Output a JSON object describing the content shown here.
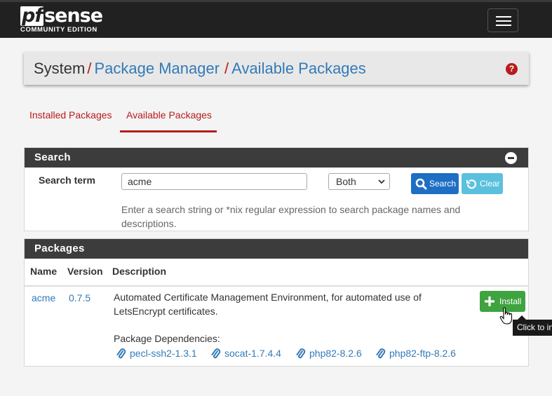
{
  "brand": {
    "logo_prefix": "pf",
    "logo_rest": "sense",
    "edition": "COMMUNITY EDITION"
  },
  "breadcrumb": {
    "root": "System",
    "sep": "/",
    "level1": "Package Manager",
    "level2": "Available Packages",
    "help_glyph": "?"
  },
  "tabs": [
    {
      "label": "Installed Packages",
      "active": false
    },
    {
      "label": "Available Packages",
      "active": true
    }
  ],
  "search": {
    "heading": "Search",
    "term_label": "Search term",
    "term_value": "acme",
    "scope_value": "Both",
    "search_button": "Search",
    "clear_button": "Clear",
    "help_text": "Enter a search string or *nix regular expression to search package names and descriptions."
  },
  "packages": {
    "heading": "Packages",
    "columns": [
      "Name",
      "Version",
      "Description"
    ],
    "rows": [
      {
        "name": "acme",
        "version": "0.7.5",
        "description": "Automated Certificate Management Environment, for automated use of LetsEncrypt certificates.",
        "deps_label": "Package Dependencies:",
        "deps": [
          "pecl-ssh2-1.3.1",
          "socat-1.7.4.4",
          "php82-8.2.6",
          "php82-ftp-8.2.6"
        ],
        "install_button": "Install"
      }
    ]
  },
  "tooltip": "Click to install",
  "colors": {
    "navbar": "#212121",
    "accent_red": "#b71c1c",
    "link_blue": "#337ab7",
    "panel_head": "#3c3c3c",
    "search_btn": "#1e6fc4",
    "clear_btn": "#5bc0de",
    "install_btn": "#3fa33f"
  },
  "icons": {
    "help": "question-circle-icon",
    "collapse": "minus-circle-icon",
    "search": "search-icon",
    "clear": "undo-icon",
    "install": "plus-icon",
    "dependency": "paperclip-icon",
    "cursor": "hand-pointer-icon"
  }
}
